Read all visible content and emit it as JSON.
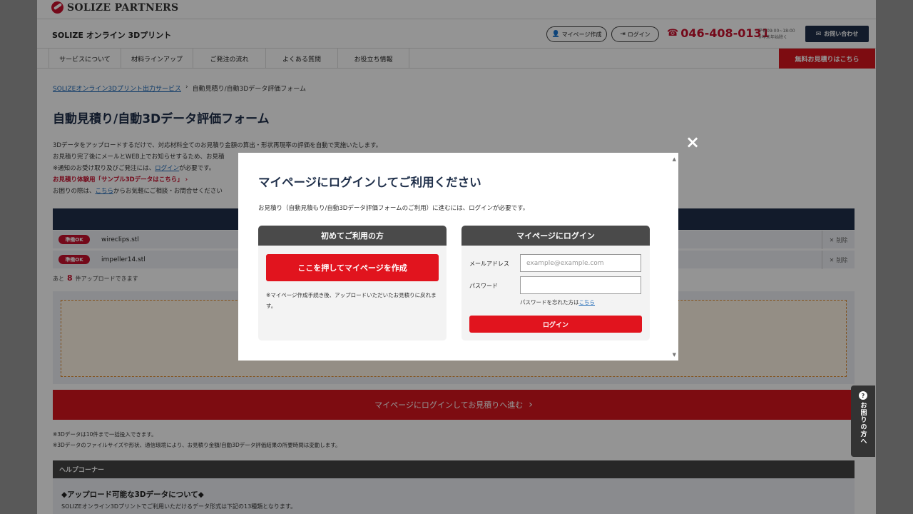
{
  "brand": {
    "logo_text": "SOLIZE PARTNERS",
    "site_name": "SOLIZE オンライン 3Dプリント",
    "accent": "#d8161e",
    "navy": "#1f2f4a"
  },
  "header": {
    "mypage_create": "マイページ作成",
    "login": "ログイン",
    "phone": "046-408-0131",
    "hours_line1": "平日09:00~18:00",
    "hours_line2": "※年末年始除く",
    "contact": "お問い合わせ"
  },
  "nav": {
    "items": [
      {
        "label": "サービスについて"
      },
      {
        "label": "材料ラインアップ"
      },
      {
        "label": "ご発注の流れ"
      },
      {
        "label": "よくある質問"
      },
      {
        "label": "お役立ち情報"
      }
    ],
    "cta": "無料お見積りはこちら"
  },
  "breadcrumb": {
    "link": "SOLIZEオンライン3Dプリント出力サービス",
    "separator": "›",
    "current": "自動見積り/自動3Dデータ評価フォーム"
  },
  "page_title": "自動見積り/自動3Dデータ評価フォーム",
  "intro": {
    "line1": "3Dデータをアップロードするだけで、対応材料全てのお見積り金額の算出・形状再現率の評価を自動で実施いたします。",
    "line2": "お見積り完了後にメールとWEB上でお知らせするため、お見積",
    "line3_pre": "※通知のお受け取り及びご発注には、",
    "line3_link": "ログイン",
    "line3_post": "が必要です。",
    "sample": "お見積り体験用「サンプル3Dデータはこちら」 ›",
    "line5_pre": "お困りの際は、",
    "line5_link": "こちら",
    "line5_post": "からお気軽にご相談・お問合せください"
  },
  "files": [
    {
      "status": "準備OK",
      "name": "wireclips.stl",
      "delete": "削除"
    },
    {
      "status": "準備OK",
      "name": "impeller14.stl",
      "delete": "削除"
    }
  ],
  "remaining": {
    "pre": "あと",
    "count": "8",
    "post": "件アップロードできます"
  },
  "proceed_button": "マイページにログインしてお見積りへ進む",
  "notes": {
    "line1": "※3Dデータは10件まで一括投入できます。",
    "line2": "※3Dデータのファイルサイズや形状、通信環境により、お見積り金額/自動3Dデータ評価結果の所要時間は変動します。"
  },
  "help": {
    "header": "ヘルプコーナー",
    "title": "◆アップロード可能な3Dデータについて◆",
    "text": "SOLIZEオンライン3Dプリントでご利用いただけるデータ形式は下記の13種類となります。"
  },
  "side_tab": {
    "icon": "?",
    "label": "お困りの方へ"
  },
  "modal": {
    "close": "×",
    "title": "マイページにログインしてご利用ください",
    "description": "お見積り（自動見積もり/自動3Dデータ評価フォームのご利用）に進むには、ログインが必要です。",
    "new_user": {
      "header": "初めてご利用の方",
      "button": "ここを押してマイページを作成",
      "note": "※マイページ作成手続き後、アップロードいただいたお見積りに戻れます。"
    },
    "login": {
      "header": "マイページにログイン",
      "email_label": "メールアドレス",
      "email_placeholder": "example@example.com",
      "password_label": "パスワード",
      "forgot_pre": "パスワードを忘れた方は",
      "forgot_link": "こちら",
      "button": "ログイン"
    }
  }
}
